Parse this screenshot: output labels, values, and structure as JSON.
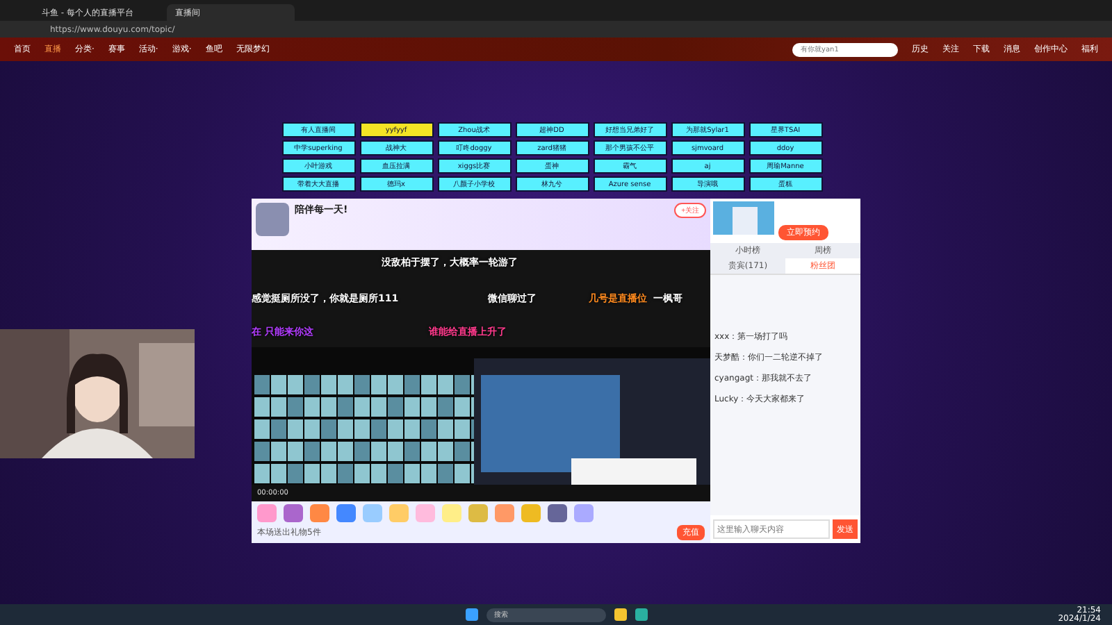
{
  "browser": {
    "tabs": [
      {
        "title": "斗鱼 - 每个人的直播平台",
        "selected": false
      },
      {
        "title": "直播间",
        "selected": true
      }
    ],
    "url": "https://www.douyu.com/topic/"
  },
  "site": {
    "nav": [
      {
        "label": "首页",
        "selected": false
      },
      {
        "label": "直播",
        "selected": true
      },
      {
        "label": "分类·",
        "selected": false
      },
      {
        "label": "赛事",
        "selected": false
      },
      {
        "label": "活动·",
        "selected": false
      },
      {
        "label": "游戏·",
        "selected": false
      },
      {
        "label": "鱼吧",
        "selected": false
      },
      {
        "label": "无限梦幻",
        "selected": false
      }
    ],
    "search_placeholder": "有你就yan1",
    "actions": [
      "历史",
      "关注",
      "下载",
      "消息",
      "创作中心",
      "福利"
    ]
  },
  "tags": [
    {
      "label": "有人直播间",
      "selected": false
    },
    {
      "label": "yyfyyf",
      "selected": true
    },
    {
      "label": "Zhou战术",
      "selected": false
    },
    {
      "label": "超神DD",
      "selected": false
    },
    {
      "label": "好想当兄弟好了",
      "selected": false
    },
    {
      "label": "为那就Sylar1",
      "selected": false
    },
    {
      "label": "星界TSAI",
      "selected": false
    },
    {
      "label": "中学superking",
      "selected": false
    },
    {
      "label": "战神大",
      "selected": false
    },
    {
      "label": "叮咚doggy",
      "selected": false
    },
    {
      "label": "zard猪猪",
      "selected": false
    },
    {
      "label": "那个男孩不公平",
      "selected": false
    },
    {
      "label": "sjmvoard",
      "selected": false
    },
    {
      "label": "ddoy",
      "selected": false
    },
    {
      "label": "小叶游戏",
      "selected": false
    },
    {
      "label": "血压拉满",
      "selected": false
    },
    {
      "label": "xiggs比赛",
      "selected": false
    },
    {
      "label": "蛋神",
      "selected": false
    },
    {
      "label": "霸气",
      "selected": false
    },
    {
      "label": "aj",
      "selected": false
    },
    {
      "label": "周瑜Manne",
      "selected": false
    },
    {
      "label": "带着大大直播",
      "selected": false
    },
    {
      "label": "德玛x",
      "selected": false
    },
    {
      "label": "八颜子小学校",
      "selected": false
    },
    {
      "label": "林九兮",
      "selected": false
    },
    {
      "label": "Azure sense",
      "selected": false
    },
    {
      "label": "导演哦",
      "selected": false
    },
    {
      "label": "蛋糕",
      "selected": false
    }
  ],
  "streamer": {
    "name": "陪伴每一天!",
    "follow": "+关注"
  },
  "danmaku": [
    {
      "text": "没敌柏于摆了，大概率一轮游了",
      "color": "#ffffff"
    },
    {
      "text": "感觉挺厕所没了，你就是厕所111",
      "color": "#ffffff"
    },
    {
      "text": "微信聊过了",
      "color": "#ffffff"
    },
    {
      "text": "几号是直播位",
      "color": "#ff8a1e"
    },
    {
      "text": "一枫哥",
      "color": "#ffffff"
    },
    {
      "text": "在 只能来你这",
      "color": "#b23cff"
    },
    {
      "text": "谁能给直播上升了",
      "color": "#ff3a8c"
    }
  ],
  "controls": {
    "time": "00:00:00"
  },
  "gift_note": "本场送出礼物5件",
  "gift_send": "充值",
  "chat": {
    "ad_button": "立即预约",
    "tabs": [
      {
        "label": "小时榜",
        "selected": false
      },
      {
        "label": "周榜",
        "selected": false
      },
      {
        "label": "贵宾(171)",
        "selected": false
      },
      {
        "label": "粉丝团",
        "selected": true
      }
    ],
    "messages": [
      {
        "user": "xxx：",
        "text": "第一场打了吗"
      },
      {
        "user": "天梦酷：",
        "text": "你们一二轮逆不掉了"
      },
      {
        "user": "cyangagt：",
        "text": "那我就不去了"
      },
      {
        "user": "Lucky：",
        "text": "今天大家都来了"
      }
    ],
    "input_placeholder": "这里输入聊天内容",
    "send": "发送"
  },
  "taskbar": {
    "search": "搜索",
    "time": "21:54",
    "date": "2024/1/24"
  }
}
